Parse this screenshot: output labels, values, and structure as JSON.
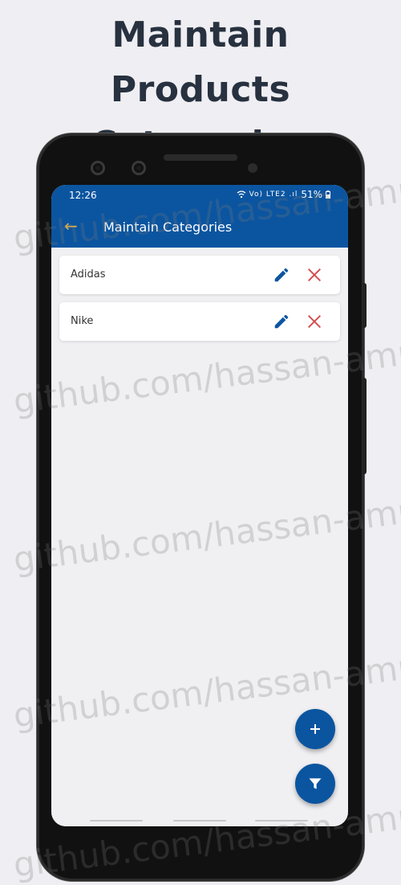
{
  "promo": {
    "line1": "Maintain",
    "line2": "Products Categories"
  },
  "status_bar": {
    "time": "12:26",
    "network_icons": "Vo) LTE2 .ıl",
    "battery": "51%"
  },
  "app_bar": {
    "title": "Maintain Categories",
    "back_icon": "arrow-back-icon"
  },
  "categories": [
    {
      "name": "Adidas"
    },
    {
      "name": "Nike"
    }
  ],
  "icons": {
    "edit": "pencil-icon",
    "delete": "close-icon",
    "add": "plus-icon",
    "filter": "filter-icon"
  },
  "colors": {
    "primary": "#0b55a0",
    "back_arrow": "#e4b44a",
    "delete": "#d24a4a",
    "edit": "#0b55a0",
    "page_bg": "#efeef2"
  },
  "watermark": "github.com/hassan-amr"
}
